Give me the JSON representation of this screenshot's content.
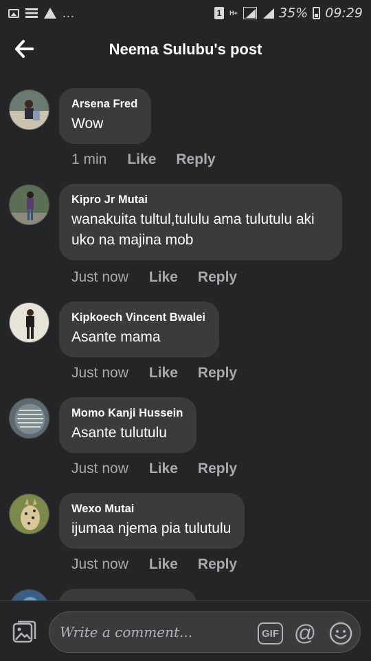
{
  "status_bar": {
    "battery_percent": "35%",
    "time": "09:29",
    "sim_label": "1",
    "network_label": "H+",
    "dots": "...",
    "icons": [
      "gallery-icon",
      "list-icon",
      "warning-icon",
      "sim-icon",
      "hplus-icon",
      "signal-icon",
      "signal-icon",
      "battery-icon"
    ]
  },
  "header": {
    "title": "Neema Sulubu's post",
    "back_icon": "arrow-left-icon"
  },
  "comments": [
    {
      "author": "Arsena Fred",
      "text": "Wow",
      "time": "1 min",
      "like": "Like",
      "reply": "Reply"
    },
    {
      "author": "Kipro Jr Mutai",
      "text": "wanakuita tultul,tululu ama tulutulu aki uko na majina mob",
      "time": "Just now",
      "like": "Like",
      "reply": "Reply"
    },
    {
      "author": "Kipkoech Vincent Bwalei",
      "text": "Asante mama",
      "time": "Just now",
      "like": "Like",
      "reply": "Reply"
    },
    {
      "author": "Momo Kanji Hussein",
      "text": "Asante tulutulu",
      "time": "Just now",
      "like": "Like",
      "reply": "Reply"
    },
    {
      "author": "Wexo Mutai",
      "text": "ijumaa njema pia tulutulu",
      "time": "Just now",
      "like": "Like",
      "reply": "Reply"
    }
  ],
  "composer": {
    "placeholder": "Write a comment...",
    "gif_label": "GIF",
    "at_label": "@",
    "icons": [
      "photo-icon",
      "gif-icon",
      "at-icon",
      "emoji-icon"
    ]
  },
  "colors": {
    "background": "#242526",
    "bubble": "#3a3b3c",
    "meta_text": "#a8aaad"
  }
}
